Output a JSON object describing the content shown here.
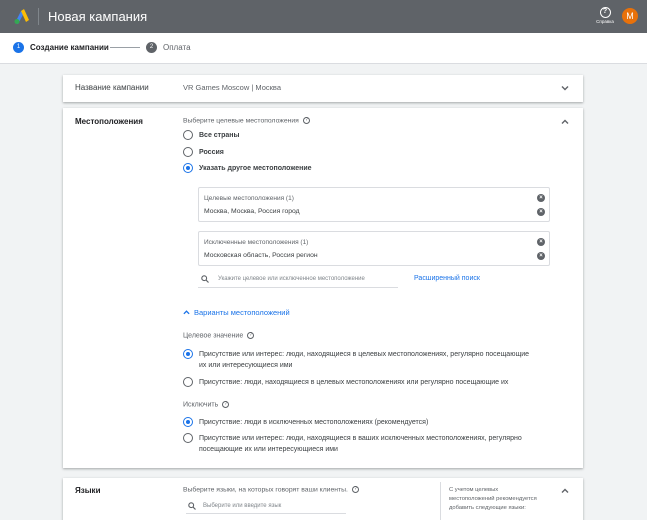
{
  "topbar": {
    "title": "Новая кампания",
    "help_label": "Справка",
    "avatar_letter": "М",
    "bg_color": "#5f6368"
  },
  "stepper": {
    "steps": [
      {
        "num": "1",
        "label": "Создание кампании",
        "active": true
      },
      {
        "num": "2",
        "label": "Оплата",
        "active": false
      }
    ]
  },
  "campaign_name": {
    "label": "Название кампании",
    "value": "VR Games Moscow | Москва"
  },
  "locations": {
    "label": "Местоположения",
    "prompt": "Выберите целевые местоположения",
    "options": [
      {
        "label": "Все страны",
        "selected": false
      },
      {
        "label": "Россия",
        "selected": false
      },
      {
        "label": "Указать другое местоположение",
        "selected": true
      }
    ],
    "targeted": {
      "title": "Целевые местоположения (1)",
      "value": "Москва, Москва, Россия город"
    },
    "excluded": {
      "title": "Исключенные местоположения (1)",
      "value": "Московская область, Россия регион"
    },
    "search_placeholder": "Укажите целевое или исключенное местоположение",
    "advanced_search": "Расширенный поиск",
    "variants_link": "Варианты местоположений",
    "target_heading": "Целевое значение",
    "target_options": [
      {
        "line1": "Присутствие или интерес: люди, находящиеся в целевых местоположениях, регулярно посещающие",
        "line2": "их или интересующиеся ими",
        "selected": true
      },
      {
        "line1": "Присутствие: люди, находящиеся в целевых местоположениях или регулярно посещающие их",
        "line2": "",
        "selected": false
      }
    ],
    "exclude_heading": "Исключить",
    "exclude_options": [
      {
        "line1": "Присутствие: люди в исключенных местоположениях (рекомендуется)",
        "line2": "",
        "selected": true
      },
      {
        "line1": "Присутствие или интерес: люди, находящиеся в ваших исключенных местоположениях, регулярно",
        "line2": "посещающие их или интересующиеся ими",
        "selected": false
      }
    ]
  },
  "languages": {
    "label": "Языки",
    "prompt": "Выберите языки, на которых говорят ваши клиенты.",
    "search_placeholder": "Выберите или введите язык",
    "hint_line1": "С учетом целевых",
    "hint_line2": "местоположений рекомендуется",
    "hint_line3": "добавить следующие языки:"
  },
  "colors": {
    "accent": "#1a73e8",
    "avatar": "#e8710a"
  }
}
